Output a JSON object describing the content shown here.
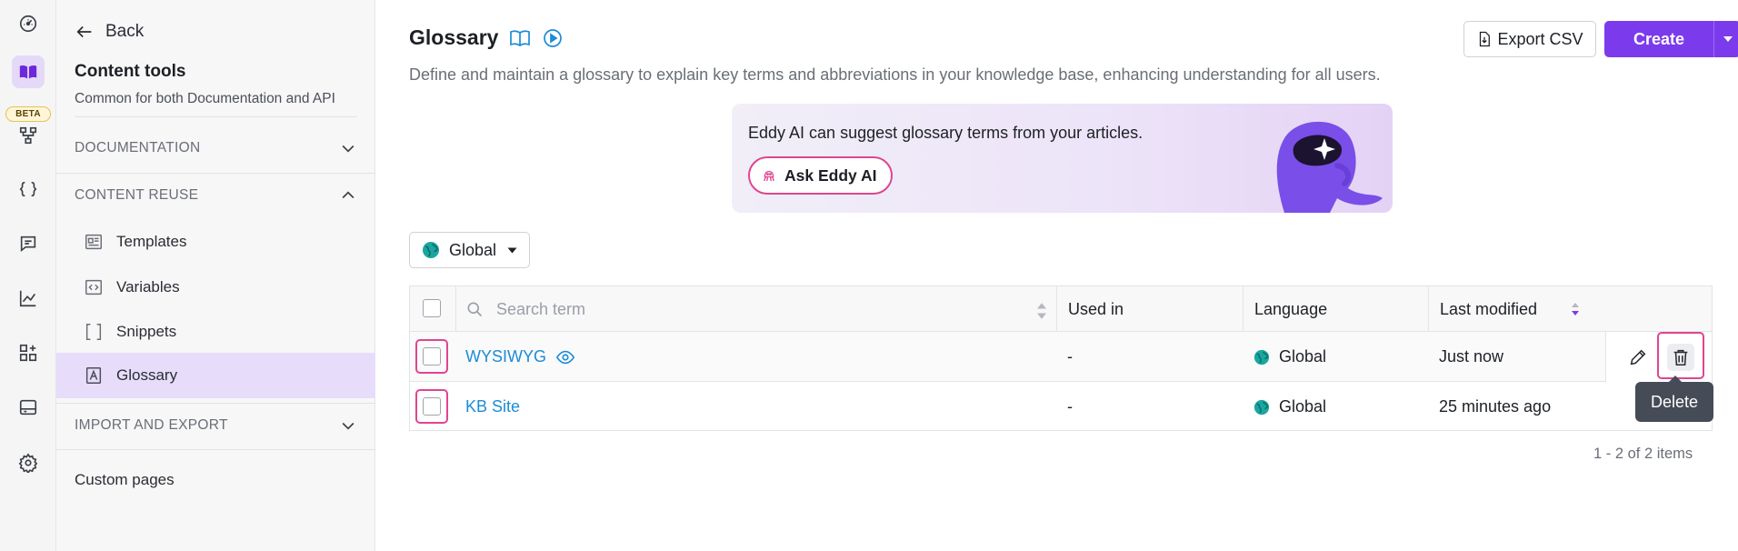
{
  "rail": {
    "beta_label": "BETA"
  },
  "sidebar": {
    "back_label": "Back",
    "title": "Content tools",
    "subtitle": "Common for both Documentation and API",
    "sections": [
      {
        "label": "DOCUMENTATION",
        "expanded": false
      },
      {
        "label": "CONTENT REUSE",
        "expanded": true
      },
      {
        "label": "IMPORT AND EXPORT",
        "expanded": false
      }
    ],
    "items": [
      {
        "label": "Templates",
        "icon": "templates-icon"
      },
      {
        "label": "Variables",
        "icon": "variables-icon"
      },
      {
        "label": "Snippets",
        "icon": "snippets-icon"
      },
      {
        "label": "Glossary",
        "icon": "glossary-icon",
        "active": true
      }
    ],
    "custom_pages": "Custom pages"
  },
  "header": {
    "title": "Glossary",
    "description": "Define and maintain a glossary to explain key terms and abbreviations in your knowledge base, enhancing understanding for all users.",
    "export_label": "Export CSV",
    "create_label": "Create"
  },
  "banner": {
    "text": "Eddy AI can suggest glossary terms from your articles.",
    "button_label": "Ask Eddy AI"
  },
  "filter": {
    "language_label": "Global"
  },
  "table": {
    "search_placeholder": "Search term",
    "columns": [
      "Used in",
      "Language",
      "Last modified"
    ],
    "rows": [
      {
        "term": "WYSIWYG",
        "used_in": "-",
        "language": "Global",
        "last_modified": "Just now"
      },
      {
        "term": "KB Site",
        "used_in": "-",
        "language": "Global",
        "last_modified": "25 minutes ago"
      }
    ],
    "tooltip": "Delete",
    "pagination": "1 - 2 of 2 items"
  },
  "colors": {
    "accent": "#7c3aed",
    "highlight": "#e0458f",
    "link": "#1c8cd6",
    "active_bg": "#e7ddfb"
  }
}
